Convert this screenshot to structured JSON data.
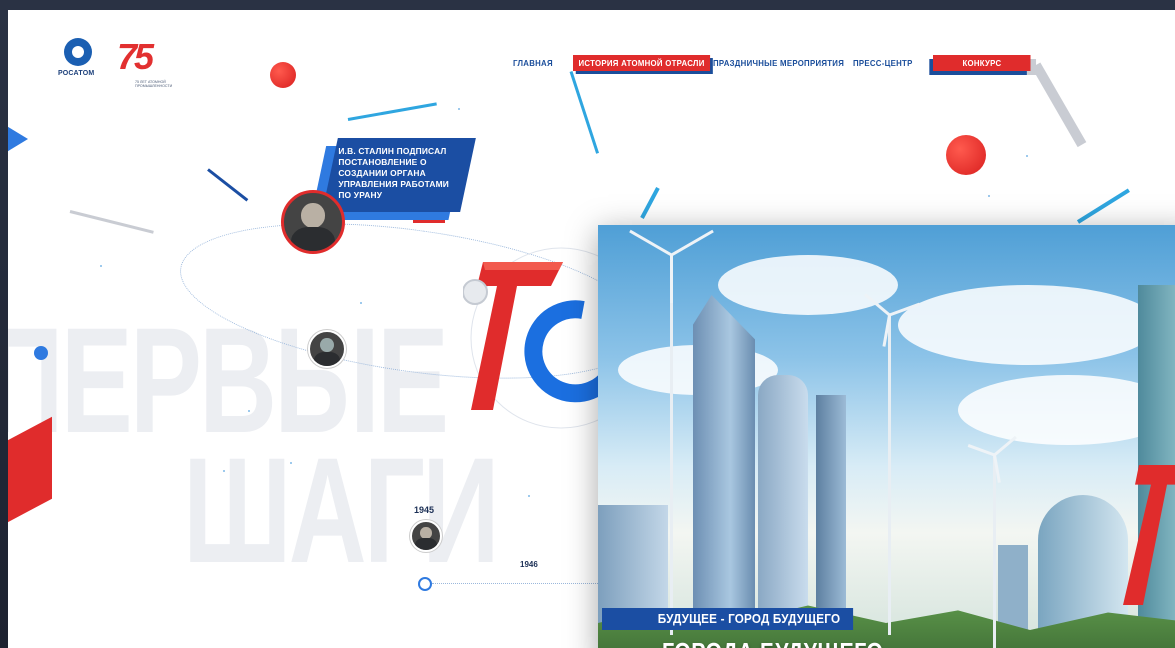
{
  "brand": {
    "rosatom_name": "РОСАТОМ",
    "logo75_number": "75",
    "logo75_caption": "75 ЛЕТ АТОМНОЙ ПРОМЫШЛЕННОСТИ"
  },
  "nav": {
    "items": [
      {
        "label": "ГЛАВНАЯ"
      },
      {
        "label": "ИСТОРИЯ АТОМНОЙ ОТРАСЛИ"
      },
      {
        "label": "ПРАЗДНИЧНЫЕ МЕРОПРИЯТИЯ"
      },
      {
        "label": "ПРЕСС-ЦЕНТР"
      },
      {
        "label": "КОНКУРС"
      }
    ],
    "active_index": 1
  },
  "hero": {
    "word1": "ПЕРВЫЕ",
    "word2": "ШАГИ"
  },
  "timeline": {
    "event_text": "И.В. СТАЛИН ПОДПИСАЛ ПОСТАНОВЛЕНИЕ О СОЗДАНИИ ОРГАНА УПРАВЛЕНИЯ РАБОТАМИ ПО УРАНУ",
    "years": [
      "1945",
      "1946"
    ]
  },
  "card": {
    "tag": "БУДУЩЕЕ - ГОРОД БУДУЩЕГО",
    "title": "ГОРОДА БУДУЩЕГО"
  },
  "colors": {
    "brand_blue": "#1b4ea3",
    "brand_red": "#e02c2c",
    "accent_light_blue": "#2f9fe0"
  }
}
